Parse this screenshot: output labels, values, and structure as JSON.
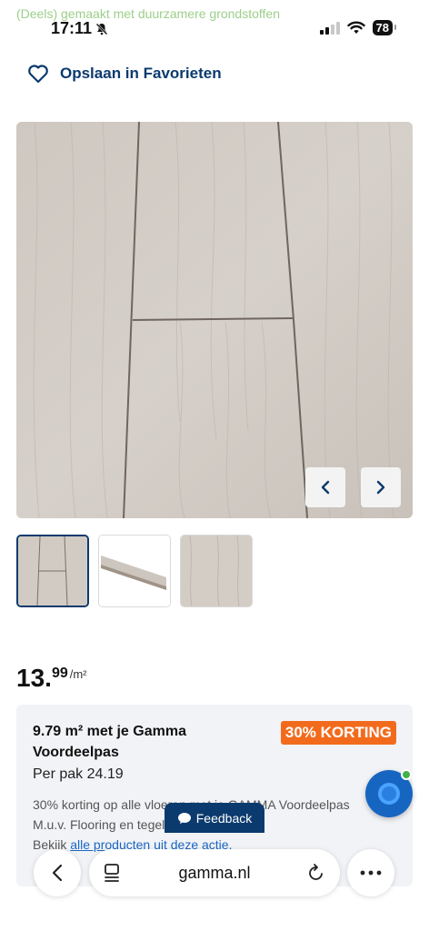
{
  "status_bar": {
    "overlay_text": "(Deels) gemaakt met duurzamere grondstoffen",
    "time": "17:11",
    "battery": "78"
  },
  "favorites": {
    "label": "Opslaan in Favorieten",
    "icon": "heart-outline-icon"
  },
  "gallery": {
    "prev_icon": "chevron-left-icon",
    "next_icon": "chevron-right-icon",
    "thumbnail_count": 3,
    "active_thumbnail": 1
  },
  "price": {
    "main": "13.",
    "cents": "99",
    "unit": "/m²"
  },
  "promo": {
    "title": "9.79 m² met je Gamma Voordeelpas",
    "badge": "30% KORTING",
    "per_pack": "Per pak 24.19",
    "desc_line1": "30% korting op alle vloeren met je GAMMA Voordeelpas",
    "desc_line2": "M.u.v. Flooring en tegels.",
    "desc_line3_prefix": "Bekijk ",
    "desc_link": "alle producten uit deze actie.",
    "desc_line3_suffix": ""
  },
  "feedback": {
    "label": "Feedback"
  },
  "browser": {
    "url": "gamma.nl"
  },
  "colors": {
    "brand_blue": "#0b3a6e",
    "badge_orange": "#f26b1d",
    "link_blue": "#1a66c4",
    "chat_blue": "#1665c1"
  }
}
